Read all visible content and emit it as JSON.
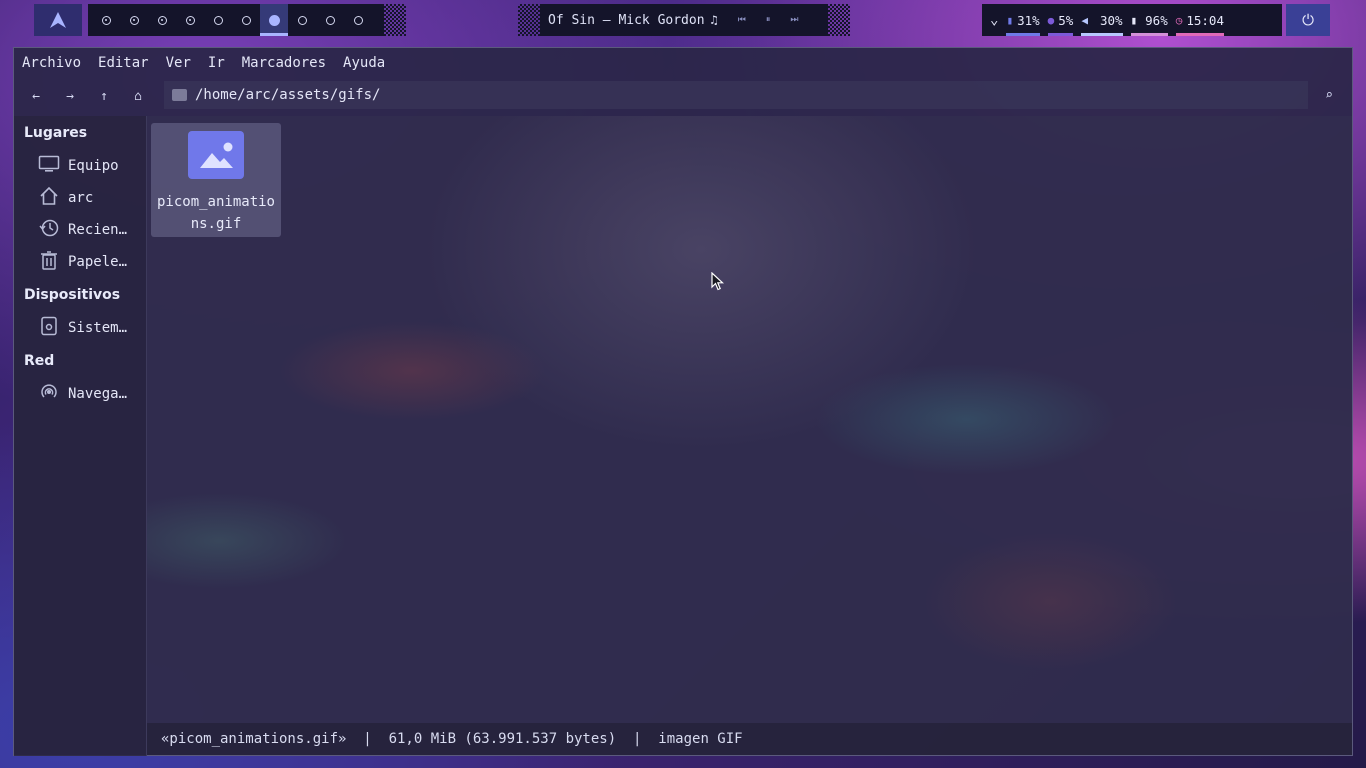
{
  "topbar": {
    "launcher_icon": "arch-logo-icon",
    "workspaces": [
      {
        "state": "occupied"
      },
      {
        "state": "occupied"
      },
      {
        "state": "occupied"
      },
      {
        "state": "occupied"
      },
      {
        "state": "empty"
      },
      {
        "state": "empty"
      },
      {
        "state": "active"
      },
      {
        "state": "empty"
      },
      {
        "state": "empty"
      },
      {
        "state": "empty"
      }
    ],
    "music": {
      "song": "Of Sin — Mick Gordon",
      "note": "♫",
      "prev": "⏮",
      "pause": "⏸",
      "next": "⏭"
    },
    "status": {
      "chevron": "⌄",
      "cpu": "31%",
      "memory": "5%",
      "volume": "30%",
      "battery": "96%",
      "time": "15:04"
    },
    "power": "⏻",
    "colors": {
      "cpu": "#6f7ae8",
      "memory": "#7c5ad8",
      "volume": "#b8c8ff",
      "battery": "#d490d8",
      "time": "#e06ab8"
    }
  },
  "window": {
    "menu": [
      "Archivo",
      "Editar",
      "Ver",
      "Ir",
      "Marcadores",
      "Ayuda"
    ],
    "nav": {
      "back": "←",
      "forward": "→",
      "up": "↑",
      "home": "⌂"
    },
    "path": "/home/arc/assets/gifs/",
    "search_icon": "⌕",
    "sidebar": {
      "places_title": "Lugares",
      "places": [
        {
          "label": "Equipo",
          "icon": "computer-icon"
        },
        {
          "label": "arc",
          "icon": "home-icon"
        },
        {
          "label": "Recien…",
          "icon": "recent-icon"
        },
        {
          "label": "Papele…",
          "icon": "trash-icon"
        }
      ],
      "devices_title": "Dispositivos",
      "devices": [
        {
          "label": "Sistem…",
          "icon": "drive-icon"
        }
      ],
      "network_title": "Red",
      "network": [
        {
          "label": "Navega…",
          "icon": "network-icon"
        }
      ]
    },
    "files": [
      {
        "name": "picom_animations.gif",
        "line1": "picom_animatio",
        "line2": "ns.gif"
      }
    ],
    "statusbar": "«picom_animations.gif»  |  61,0 MiB (63.991.537 bytes)  |  imagen GIF"
  }
}
